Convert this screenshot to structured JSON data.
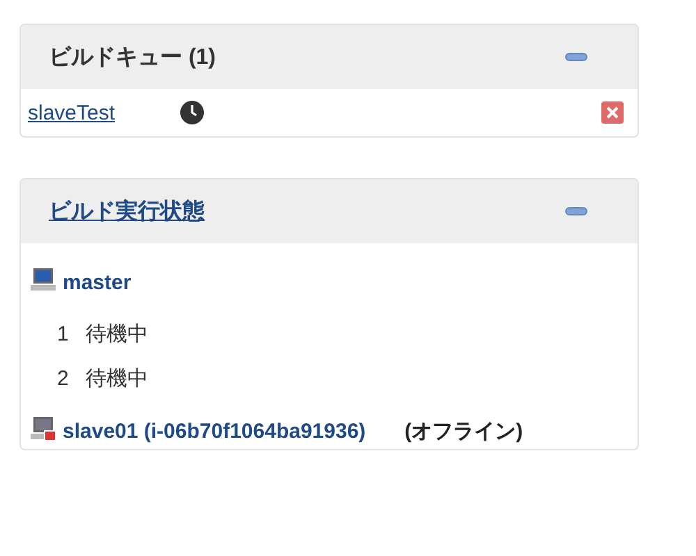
{
  "build_queue": {
    "title": "ビルドキュー (1)",
    "expanded": true,
    "items": [
      {
        "name": "slaveTest"
      }
    ]
  },
  "executors_panel": {
    "title": "ビルド実行状態",
    "expanded": true,
    "nodes": [
      {
        "name": "master",
        "offline": false,
        "executors": [
          {
            "number": "1",
            "state": "待機中"
          },
          {
            "number": "2",
            "state": "待機中"
          }
        ]
      },
      {
        "name": "slave01 (i-06b70f1064ba91936)",
        "offline": true,
        "status": "(オフライン)"
      }
    ]
  }
}
